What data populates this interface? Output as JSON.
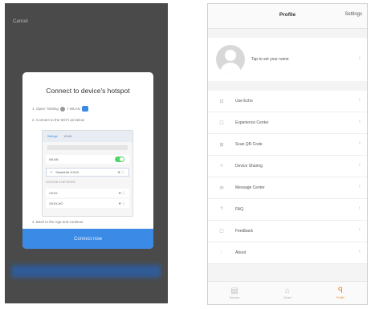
{
  "left": {
    "cancel": "Cancel",
    "modal_title": "Connect to device's hotspot",
    "step1_prefix": "1. Open \"Setting",
    "step1_suffix": "> WLAN",
    "step2": "2. Connect to the Wi-Fi as below",
    "mock": {
      "tab_a": "Settings",
      "tab_b": "WLAN",
      "wlan_label": "WLAN",
      "network_name": "SmartLife-XXXX",
      "section_label": "CHOOSE A NETWORK",
      "other1": "XXXX",
      "other2": "XXXX-5G"
    },
    "step3": "3. Back to the App and continue",
    "connect_button": "Connect now"
  },
  "right": {
    "title": "Profile",
    "settings": "Settings",
    "profile_prompt": "Tap to set your name",
    "menu": [
      {
        "label": "Use Echo",
        "icon": "⊡"
      },
      {
        "label": "Experience Center",
        "icon": "☐"
      },
      {
        "label": "Scan QR Code",
        "icon": "⊞"
      },
      {
        "label": "Device Sharing",
        "icon": "<"
      },
      {
        "label": "Message Center",
        "icon": "✉"
      },
      {
        "label": "FAQ",
        "icon": "?"
      },
      {
        "label": "Feedback",
        "icon": "☐"
      },
      {
        "label": "About",
        "icon": "◌"
      }
    ],
    "tabs": [
      {
        "label": "Devices",
        "icon": "▤"
      },
      {
        "label": "Smart",
        "icon": "⌂"
      },
      {
        "label": "Profile",
        "icon": "ꟼ"
      }
    ],
    "accent": "#f08a2c"
  },
  "colors": {
    "primary_blue": "#3b8ae6",
    "toggle_green": "#4cd964"
  }
}
